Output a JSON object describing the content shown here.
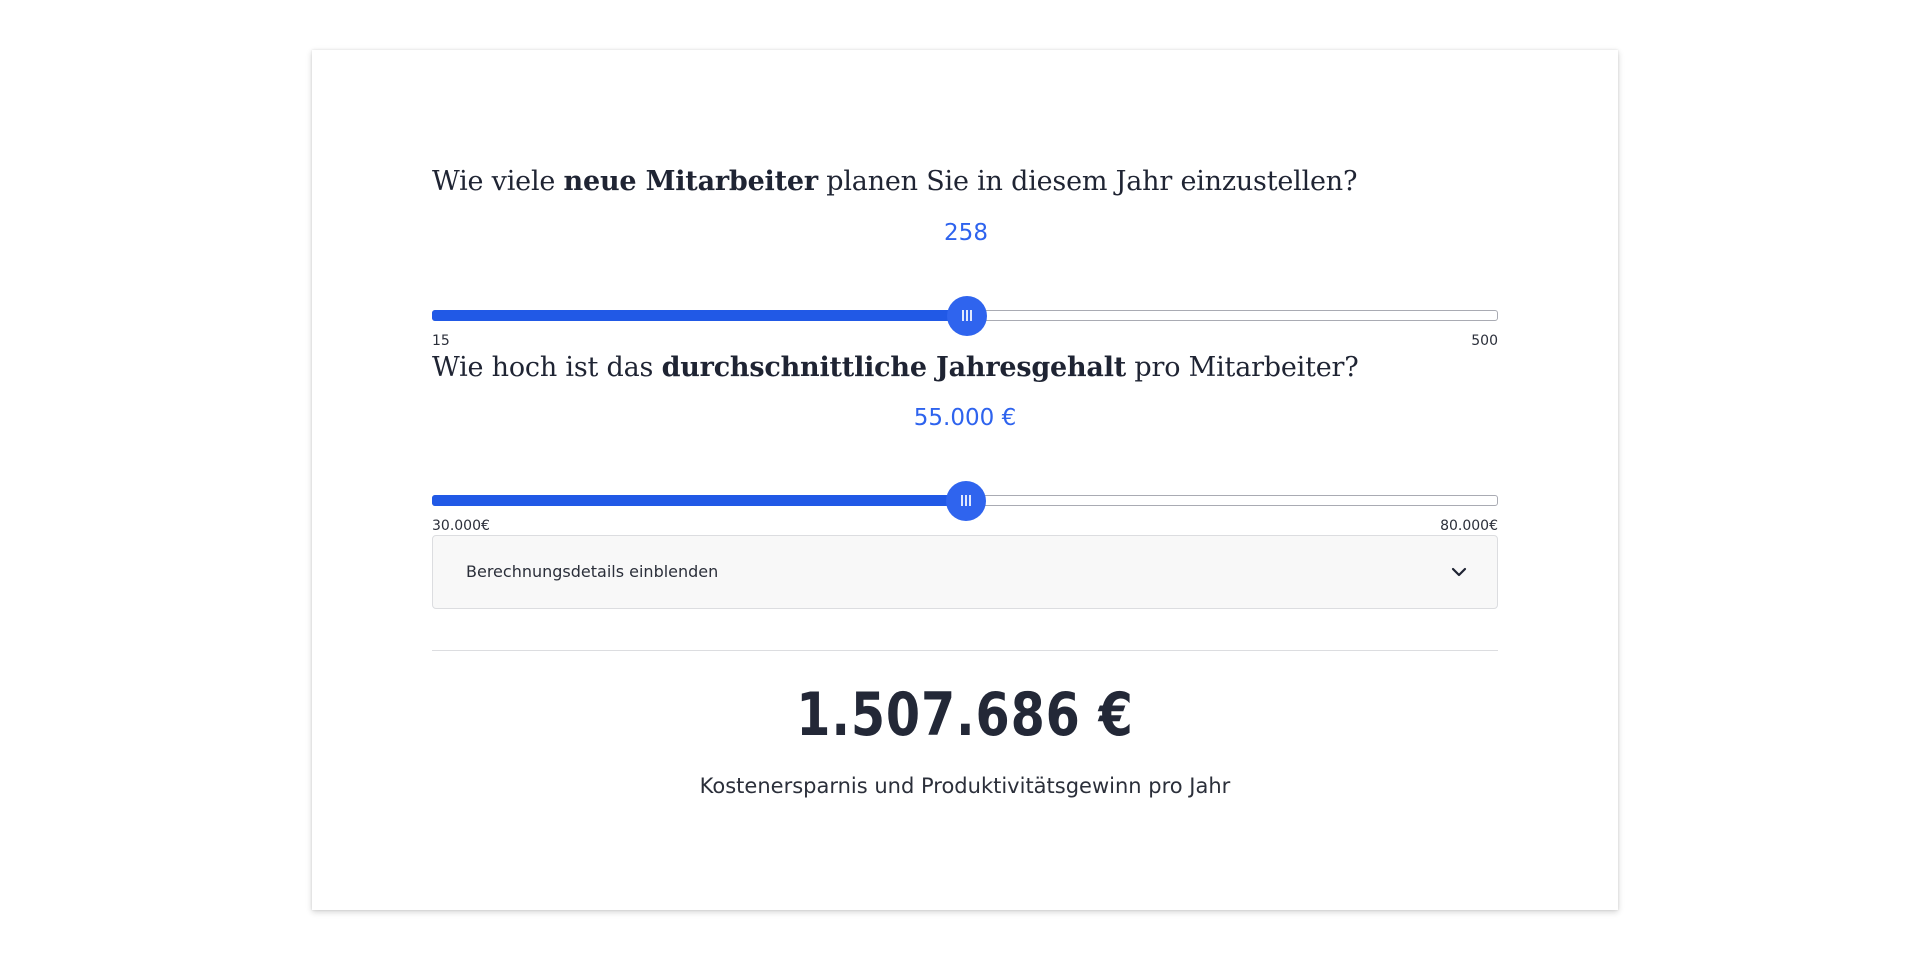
{
  "q1": {
    "prefix": "Wie viele ",
    "bold": "neue Mitarbeiter",
    "suffix": " planen Sie in diesem Jahr einzustellen?",
    "value_label": "258",
    "value": 258,
    "min": 15,
    "max": 500,
    "min_label": "15",
    "max_label": "500"
  },
  "q2": {
    "prefix": "Wie hoch ist das ",
    "bold": "durchschnittliche Jahresgehalt",
    "suffix": " pro Mitarbeiter?",
    "value_label": "55.000 €",
    "value": 55000,
    "min": 30000,
    "max": 80000,
    "min_label": "30.000€",
    "max_label": "80.000€"
  },
  "details": {
    "label": "Berechnungsdetails einblenden",
    "icon": "chevron-down-icon"
  },
  "result": {
    "amount": "1.507.686 €",
    "caption": "Kostenersparnis und Produktivitätsgewinn pro Jahr"
  },
  "colors": {
    "accent": "#2e63ee",
    "fill": "#2159e6",
    "text": "#1f2433"
  }
}
